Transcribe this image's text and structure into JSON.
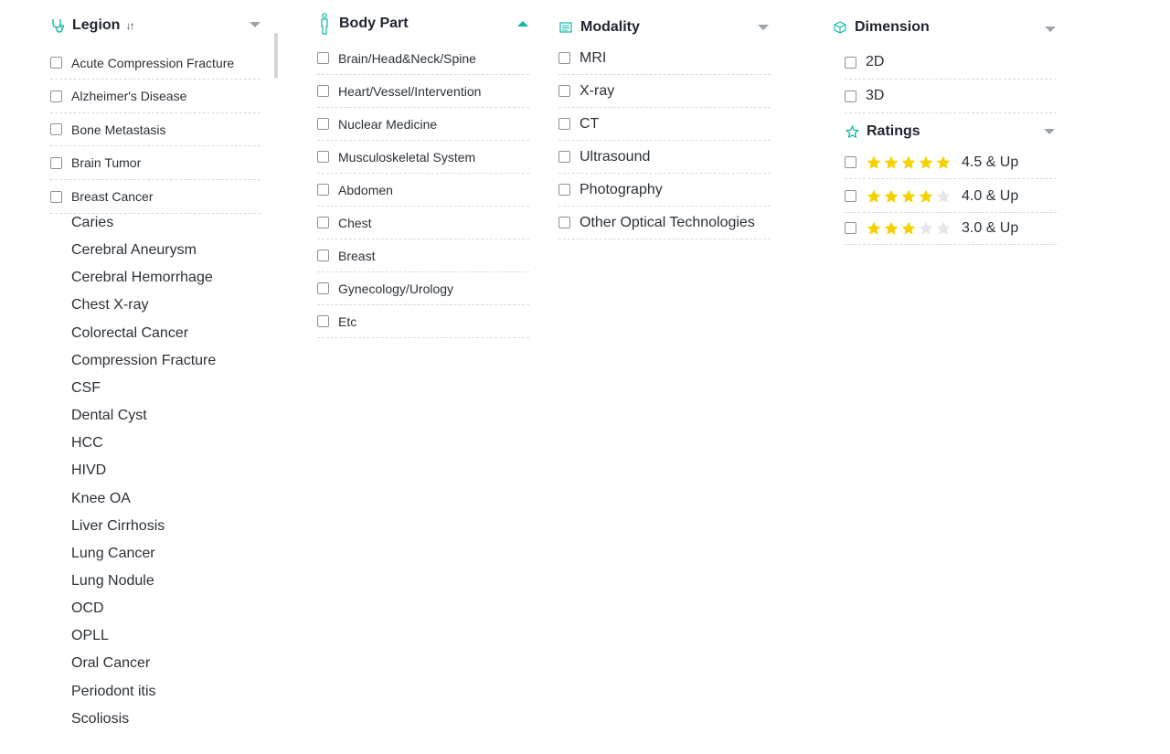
{
  "legion": {
    "title": "Legion",
    "checkbox_items": [
      "Acute Compression Fracture",
      "Alzheimer's Disease",
      "Bone Metastasis",
      "Brain Tumor",
      "Breast Cancer"
    ],
    "list_items": [
      "Caries",
      "Cerebral Aneurysm",
      "Cerebral Hemorrhage",
      "Chest X-ray",
      "Colorectal Cancer",
      "Compression Fracture",
      "CSF",
      "Dental Cyst",
      "HCC",
      "HIVD",
      "Knee OA",
      "Liver Cirrhosis",
      "Lung Cancer",
      "Lung Nodule",
      "OCD",
      "OPLL",
      "Oral Cancer",
      "Periodont itis",
      "Scoliosis"
    ]
  },
  "body_part": {
    "title": "Body Part",
    "items": [
      "Brain/Head&Neck/Spine",
      "Heart/Vessel/Intervention",
      "Nuclear Medicine",
      "Musculoskeletal System",
      "Abdomen",
      "Chest",
      "Breast",
      "Gynecology/Urology",
      "Etc"
    ]
  },
  "modality": {
    "title": "Modality",
    "items": [
      "MRI",
      "X-ray",
      "CT",
      "Ultrasound",
      "Photography",
      "Other Optical Technologies"
    ]
  },
  "dimension": {
    "title": "Dimension",
    "items": [
      "2D",
      "3D"
    ]
  },
  "ratings": {
    "title": "Ratings",
    "items": [
      {
        "label": "4.5 & Up",
        "stars": 5
      },
      {
        "label": "4.0 & Up",
        "stars": 4
      },
      {
        "label": "3.0 & Up",
        "stars": 3
      }
    ]
  },
  "colors": {
    "accent": "#12b5a6",
    "star_filled": "#f5d100",
    "star_empty": "#e3e5e8",
    "text": "#1f2530"
  },
  "icons": {
    "legion": "stethoscope-icon",
    "body_part": "person-icon",
    "modality": "monitor-icon",
    "dimension": "cube-icon",
    "ratings": "star-outline-icon",
    "sort": "sort-icon",
    "collapse": "chevron-icon"
  }
}
